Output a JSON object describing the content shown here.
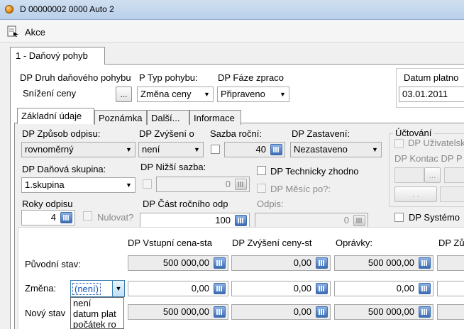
{
  "window": {
    "title": "D 00000002 0000 Auto 2"
  },
  "actionbar": {
    "akce_label": "Akce"
  },
  "outer_tab": "1 - Daňový pohyb",
  "header": {
    "druh_label": "DP Druh daňového pohybu",
    "druh_value": "Snížení ceny",
    "typ_label": "P Typ pohybu:",
    "typ_value": "Změna ceny",
    "faze_label": "DP Fáze zpraco",
    "faze_value": "Připraveno",
    "datum_label": "Datum platno",
    "datum_value": "03.01.2011",
    "dots": "..."
  },
  "tabs": [
    "Základní údaje",
    "Poznámka",
    "Další...",
    "Informace"
  ],
  "fields": {
    "zpusob_label": "DP Způsob odpisu:",
    "zpusob_value": "rovnoměrný",
    "zvyseni_label": "DP Zvýšení o",
    "zvyseni_value": "není",
    "sazba_label": "Sazba roční:",
    "sazba_value": "40",
    "zastaveni_label": "DP Zastavení:",
    "zastaveni_value": "Nezastaveno",
    "skupina_label": "DP Daňová skupina:",
    "skupina_value": "1.skupina",
    "nizsi_label": "DP Nižší sazba:",
    "nizsi_value": "0",
    "technicky_label": "DP Technicky zhodno",
    "mesic_label": "DP Měsíc po?:",
    "roky_label": "Roky odpisu",
    "roky_value": "4",
    "nulovat_label": "Nulovat?",
    "cast_label": "DP Část ročního odp",
    "cast_value": "100",
    "odpis_label": "Odpis:",
    "odpis_value": "0"
  },
  "uctovani": {
    "title": "Účtování",
    "uzivatel_label": "DP Uživatelsk",
    "kontace_label": "DP Kontac DP P",
    "dots": "...",
    "dots2": ". .",
    "systemovy_label": "DP Systémo"
  },
  "table": {
    "col_headers": [
      "DP Vstupní cena-sta",
      "DP Zvýšení ceny-st",
      "Oprávky:",
      "DP Zů"
    ],
    "rows": [
      {
        "label": "Původní stav:",
        "values": [
          "500 000,00",
          "0,00",
          "500 000,00"
        ]
      },
      {
        "label": "Změna:",
        "values": [
          "0,00",
          "0,00",
          "0,00"
        ]
      },
      {
        "label": "Nový stav",
        "values": [
          "500 000,00",
          "0,00",
          "500 000,00"
        ]
      }
    ],
    "zmena_combo_value": "(není)"
  },
  "dropdown_options": [
    "není",
    "datum plat",
    "počátek ro"
  ]
}
